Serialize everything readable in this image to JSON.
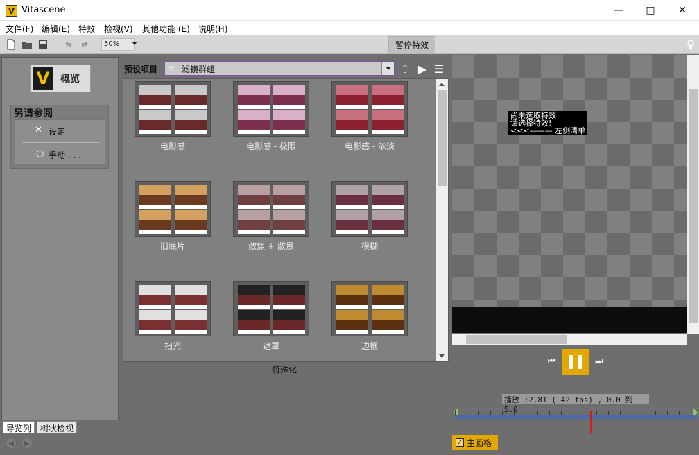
{
  "window": {
    "title": "Vitascene -",
    "logo_letter": "V"
  },
  "menu": [
    "文件(F)",
    "编辑(E)",
    "特效",
    "检视(V)",
    "其他功能 (E)",
    "说明(H)"
  ],
  "toolbar": {
    "zoom": "50%",
    "pause_effect": "暂停特效"
  },
  "left_panel": {
    "overview_label": "概览",
    "see_also_title": "另请参阅",
    "items": [
      {
        "label": "设定",
        "icon": "wrench-icon"
      },
      {
        "label": "手动 . . .",
        "icon": "bulb-icon"
      }
    ],
    "tabs": [
      "导览列",
      "树状检视"
    ]
  },
  "preset": {
    "label": "预设项目",
    "value": "滤镜群组"
  },
  "gallery": {
    "tiles": [
      {
        "label": "电影感"
      },
      {
        "label": "电影感 - 极限"
      },
      {
        "label": "电影感 - 浓淡"
      },
      {
        "label": "旧底片"
      },
      {
        "label": "散焦 + 散景"
      },
      {
        "label": "模糊"
      },
      {
        "label": "扫光"
      },
      {
        "label": "遮罩"
      },
      {
        "label": "边框"
      }
    ],
    "category": "特殊化"
  },
  "preview": {
    "message": "尚未选取特效\n请选择特效!\n<<<——— 左侧清单"
  },
  "playback": {
    "info": "播放 :2.81 ( 42 fps) , 0.0 到 5.0",
    "progress": 0.56,
    "main_frame_label": "主画格"
  },
  "colors": {
    "accent": "#e3a800",
    "timeline_track": "#4d6aa8",
    "cursor": "#d81b1b"
  }
}
